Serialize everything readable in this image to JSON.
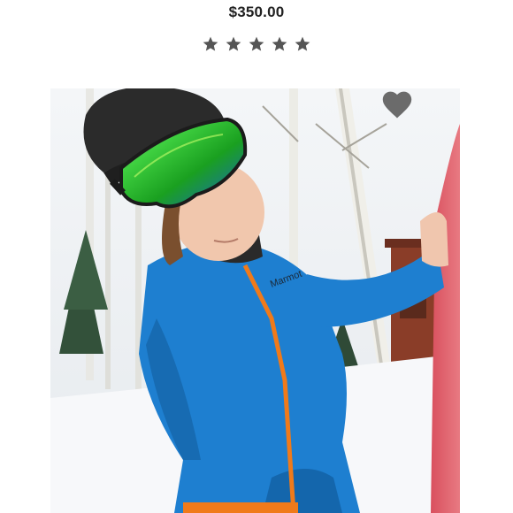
{
  "listing": {
    "price": "$350.00",
    "rating": {
      "filled": 5,
      "max": 5
    }
  },
  "photo": {
    "subject": "product-photo",
    "jacket_brand_text": "Marmot"
  },
  "icons": {
    "star": "star-icon",
    "like": "heart-icon"
  },
  "colors": {
    "price_text": "#222222",
    "star": "#555555",
    "heart": "#6b6b6b"
  }
}
